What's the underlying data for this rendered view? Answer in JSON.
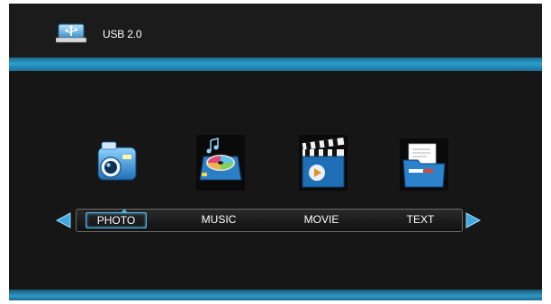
{
  "header": {
    "device_icon": "usb-drive-icon",
    "device_label": "USB 2.0"
  },
  "menu": {
    "items": [
      {
        "label": "PHOTO",
        "icon": "camera-icon",
        "selected": true
      },
      {
        "label": "MUSIC",
        "icon": "music-disc-icon",
        "selected": false
      },
      {
        "label": "MOVIE",
        "icon": "clapperboard-icon",
        "selected": false
      },
      {
        "label": "TEXT",
        "icon": "document-folder-icon",
        "selected": false
      }
    ],
    "left_arrow": "left-arrow-icon",
    "right_arrow": "right-arrow-icon"
  },
  "colors": {
    "background": "#161616",
    "accent": "#2a9fcc",
    "selection": "#4fb6e6",
    "text": "#ffffff"
  }
}
